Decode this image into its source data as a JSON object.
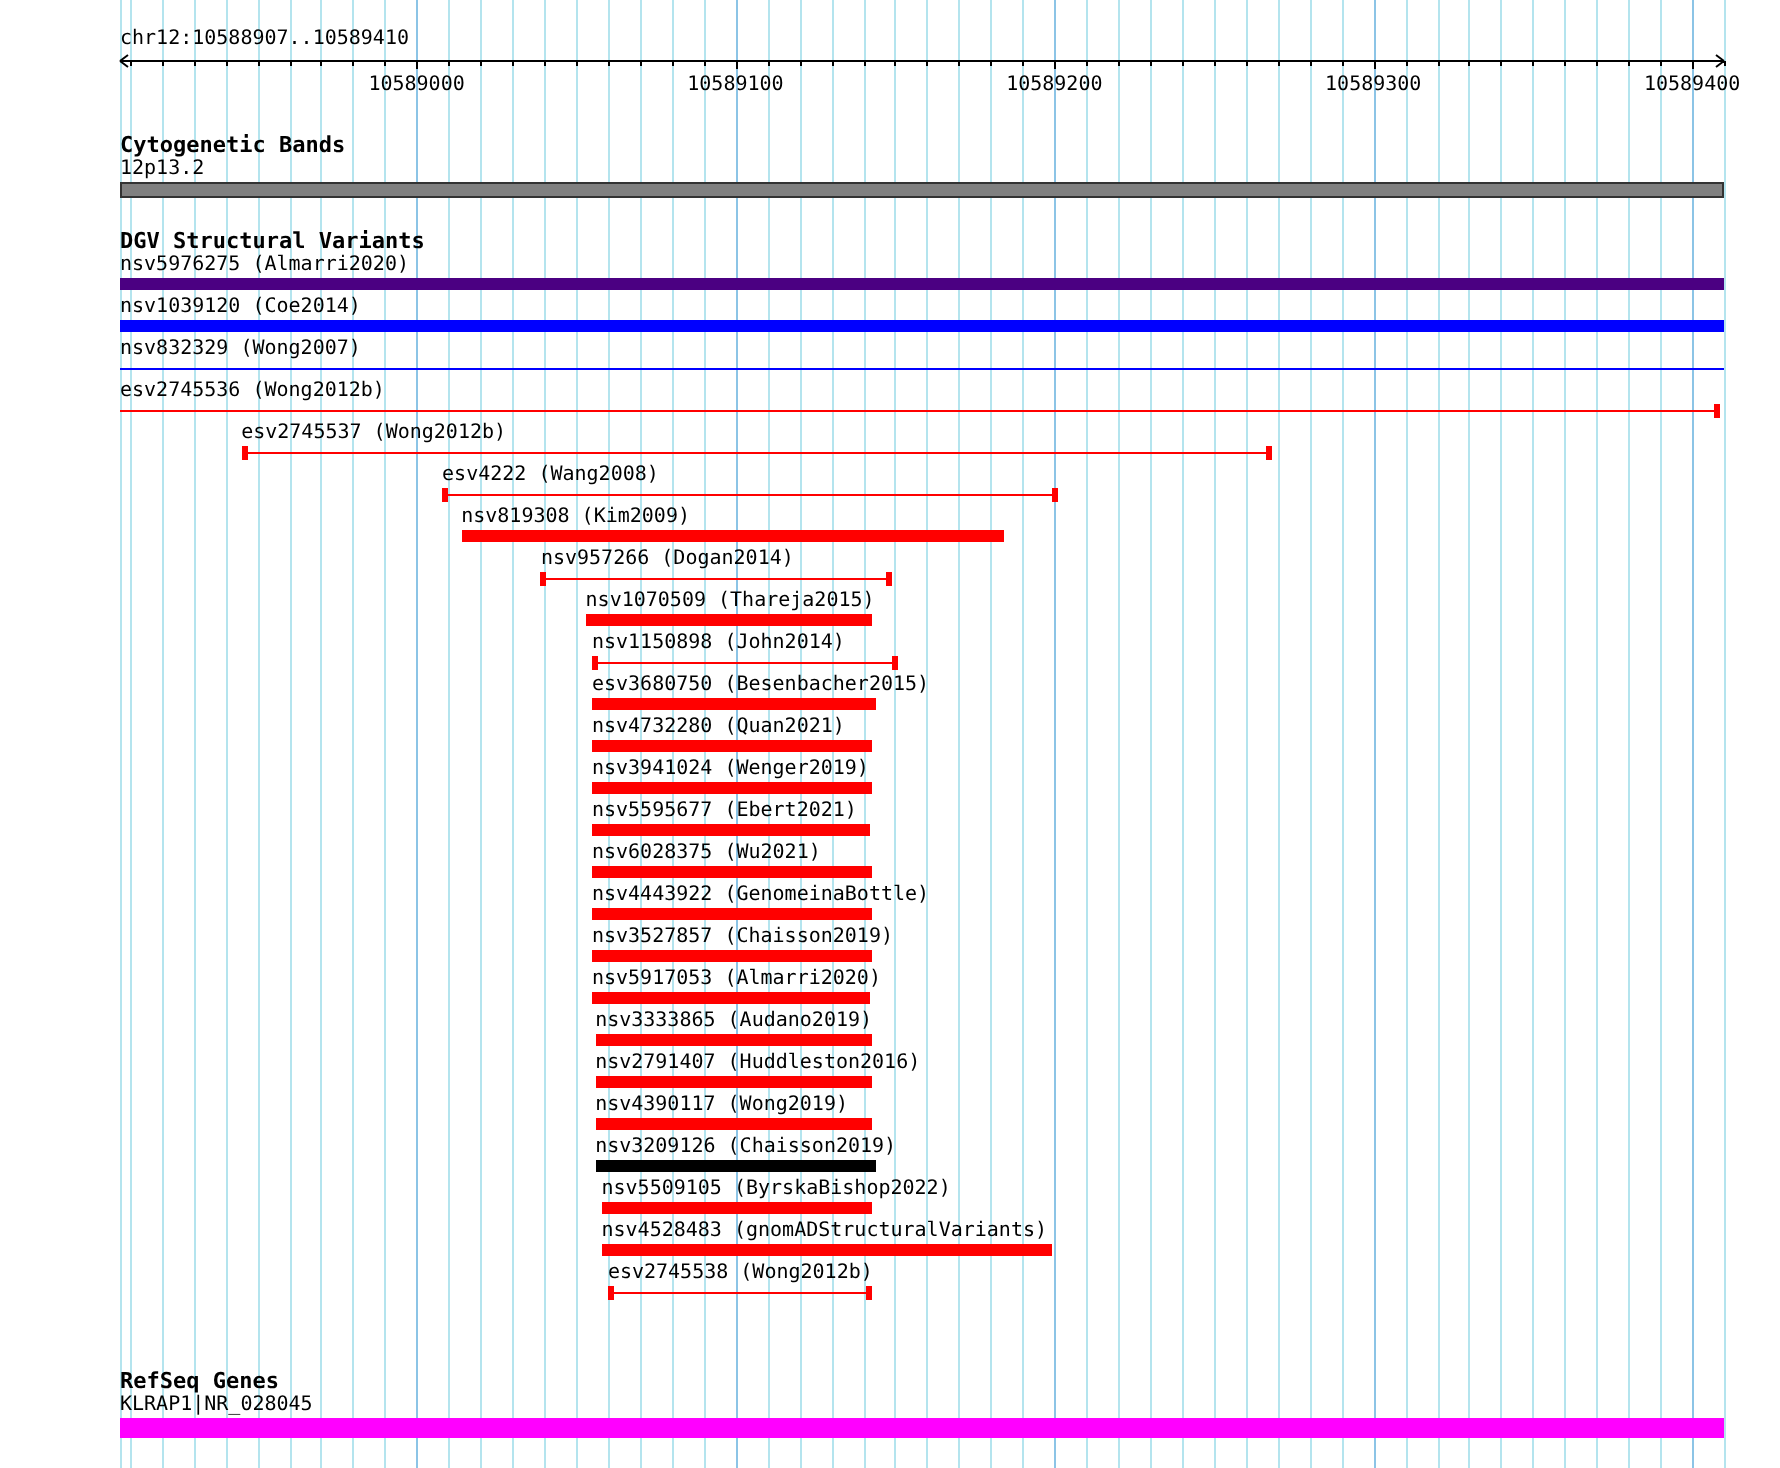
{
  "location": "chr12:10588907..10589410",
  "ruler": {
    "ticks": [
      "10589000",
      "10589100",
      "10589200",
      "10589300",
      "10589400"
    ]
  },
  "tracks": [
    {
      "title": "Cytogenetic Bands",
      "kind": "bands",
      "features": [
        {
          "label": "12p13.2",
          "kind": "band",
          "color": "#808080"
        }
      ]
    },
    {
      "title": "DGV Structural Variants",
      "kind": "variants",
      "features": [
        {
          "label": "nsv5976275 (Almarri2020)",
          "kind": "block",
          "color": "#4b0082"
        },
        {
          "label": "nsv1039120 (Coe2014)",
          "kind": "block",
          "color": "#0000ff"
        },
        {
          "label": "nsv832329 (Wong2007)",
          "kind": "line",
          "color": "#0000ff"
        },
        {
          "label": "esv2745536 (Wong2012b)",
          "kind": "line",
          "color": "#ff0000"
        },
        {
          "label": "esv2745537 (Wong2012b)",
          "kind": "line",
          "color": "#ff0000"
        },
        {
          "label": "esv4222 (Wang2008)",
          "kind": "line",
          "color": "#ff0000"
        },
        {
          "label": "nsv819308 (Kim2009)",
          "kind": "block",
          "color": "#ff0000"
        },
        {
          "label": "nsv957266 (Dogan2014)",
          "kind": "line",
          "color": "#ff0000"
        },
        {
          "label": "nsv1070509 (Thareja2015)",
          "kind": "block",
          "color": "#ff0000"
        },
        {
          "label": "nsv1150898 (John2014)",
          "kind": "line",
          "color": "#ff0000"
        },
        {
          "label": "esv3680750 (Besenbacher2015)",
          "kind": "block",
          "color": "#ff0000"
        },
        {
          "label": "nsv4732280 (Quan2021)",
          "kind": "block",
          "color": "#ff0000"
        },
        {
          "label": "nsv3941024 (Wenger2019)",
          "kind": "block",
          "color": "#ff0000"
        },
        {
          "label": "nsv5595677 (Ebert2021)",
          "kind": "block",
          "color": "#ff0000"
        },
        {
          "label": "nsv6028375 (Wu2021)",
          "kind": "block",
          "color": "#ff0000"
        },
        {
          "label": "nsv4443922 (GenomeinaBottle)",
          "kind": "block",
          "color": "#ff0000"
        },
        {
          "label": "nsv3527857 (Chaisson2019)",
          "kind": "block",
          "color": "#ff0000"
        },
        {
          "label": "nsv5917053 (Almarri2020)",
          "kind": "block",
          "color": "#ff0000"
        },
        {
          "label": "nsv3333865 (Audano2019)",
          "kind": "block",
          "color": "#ff0000"
        },
        {
          "label": "nsv2791407 (Huddleston2016)",
          "kind": "block",
          "color": "#ff0000"
        },
        {
          "label": "nsv4390117 (Wong2019)",
          "kind": "block",
          "color": "#ff0000"
        },
        {
          "label": "nsv3209126 (Chaisson2019)",
          "kind": "block",
          "color": "#000000"
        },
        {
          "label": "nsv5509105 (ByrskaBishop2022)",
          "kind": "block",
          "color": "#ff0000"
        },
        {
          "label": "nsv4528483 (gnomADStructuralVariants)",
          "kind": "block",
          "color": "#ff0000"
        },
        {
          "label": "esv2745538 (Wong2012b)",
          "kind": "line",
          "color": "#ff0000"
        }
      ]
    },
    {
      "title": "RefSeq Genes",
      "kind": "genes",
      "features": [
        {
          "label": "KLRAP1|NR_028045",
          "kind": "gene",
          "color": "#ff00ff"
        }
      ]
    }
  ]
}
